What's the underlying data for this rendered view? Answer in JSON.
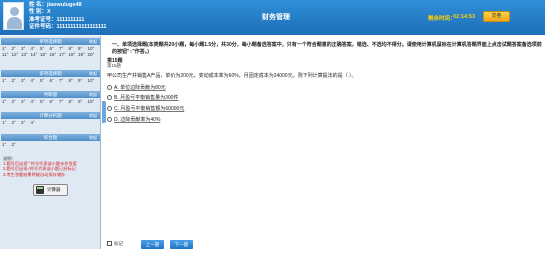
{
  "header": {
    "name_label": "姓  名：",
    "name_value": "jiaowuluge48",
    "gender_label": "性  别：",
    "gender_value": "X",
    "ticket_label": "准考证号：",
    "ticket_value": "1111111111",
    "id_label": "证件号码：",
    "id_value": "111111111111111111",
    "title": "财务管理",
    "timer_label": "剩余时间：",
    "timer_value": "02:14:53",
    "submit_label": "交卷"
  },
  "sidebar": {
    "sections": [
      {
        "title": "单项选择题",
        "collapse": "收起"
      },
      {
        "title": "多项选择题",
        "collapse": "收起"
      },
      {
        "title": "判断题",
        "collapse": "收起"
      },
      {
        "title": "计算分析题",
        "collapse": "收起"
      },
      {
        "title": "综合题",
        "collapse": "收起"
      }
    ],
    "single_rows": [
      [
        "1°",
        "2°",
        "3°",
        "4°",
        "5°",
        "6°",
        "7°",
        "8°",
        "9°",
        "10°"
      ],
      [
        "11°",
        "12°",
        "13°",
        "14°",
        "15°",
        "16°",
        "17°",
        "18°",
        "19°",
        "20°"
      ]
    ],
    "multi_rows": [
      [
        "1°",
        "2°",
        "3°",
        "4°",
        "5°",
        "6°",
        "7°",
        "8°",
        "9°",
        "10°"
      ]
    ],
    "judge_rows": [
      [
        "1°",
        "2°",
        "3°",
        "4°",
        "5°",
        "6°",
        "7°",
        "8°",
        "9°",
        "10°"
      ]
    ],
    "calc_rows": [
      [
        "1°",
        "2°",
        "3°",
        "4°"
      ]
    ],
    "comp_rows": [
      [
        "1°",
        "2°"
      ]
    ],
    "notes": {
      "title": "说明：",
      "line1": "1.题号后出现°°符号代表该小题未作答案",
      "line2": "2.题号后出现√符号代表该小题已经标记",
      "line3": "3.考生答题结果将被自动保存储存"
    },
    "calc_button": "计算器"
  },
  "main": {
    "section_text": "一、单项选择题(本类题共20小题，每小题1.5分，共30分，每小题备选答案中，只有一个符合题意的正确答案，错选、不选均不得分。请使用计算机鼠标在计算机答题界面上点击试题答案备选项前的按钮\"○\"作答。)",
    "question_no": "第15题",
    "question_sub": "第15题",
    "stem": "甲公司生产并销售A产品，单价为200元，变动成本率为60%，月固定成本为24000元，则下列计算提法的是（    ）。",
    "options": [
      "A. 单位边际贡献为80元",
      "B. 月盈亏平衡销售量为300件",
      "C. 月盈亏平衡销售额为60000元",
      "D. 边际贡献率为40%"
    ]
  },
  "footer": {
    "mark_label": "标记",
    "prev_label": "上一题",
    "next_label": "下一题"
  }
}
